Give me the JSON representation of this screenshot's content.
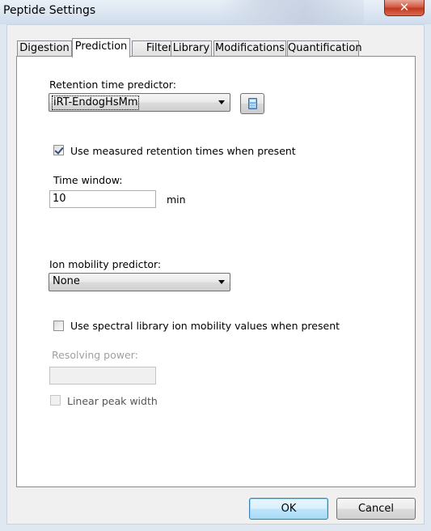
{
  "window": {
    "title": "Peptide Settings",
    "close_glyph": "✕",
    "close_icon": "close-icon"
  },
  "tabs": [
    {
      "label": "Digestion"
    },
    {
      "label": "Prediction",
      "active": true
    },
    {
      "label": "Filter"
    },
    {
      "label": "Library"
    },
    {
      "label": "Modifications"
    },
    {
      "label": "Quantification"
    }
  ],
  "prediction": {
    "rt_predictor_label": "Retention time predictor:",
    "rt_predictor_value": "iRT-EndogHsMm",
    "calculator_icon": "calculator-icon",
    "use_measured_label": "Use measured retention times when present",
    "use_measured_checked": true,
    "time_window_label": "Time window:",
    "time_window_value": "10",
    "time_window_unit": "min",
    "ion_mobility_label": "Ion mobility predictor:",
    "ion_mobility_value": "None",
    "use_spectral_label": "Use spectral library ion mobility values when present",
    "use_spectral_checked": false,
    "resolving_power_label": "Resolving power:",
    "resolving_power_value": "",
    "linear_peak_label": "Linear peak width",
    "linear_peak_checked": false
  },
  "buttons": {
    "ok_label": "OK",
    "cancel_label": "Cancel"
  }
}
